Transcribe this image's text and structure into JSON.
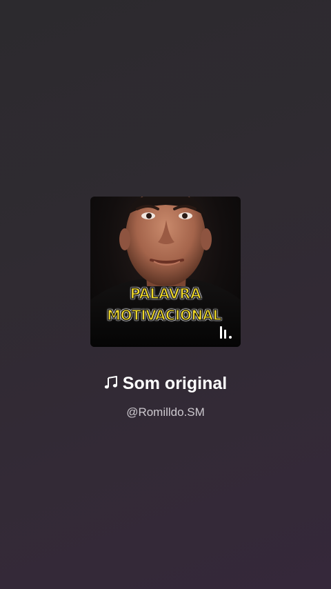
{
  "audio": {
    "cover": {
      "line1": "PALAVRA",
      "line2": "MOTIVACIONAL"
    },
    "title": "Som original",
    "author": "@Romilldo.SM",
    "icons": {
      "title_icon": "music-note-icon",
      "cover_badge": "sound-bars-icon"
    },
    "colors": {
      "background": "#302b33",
      "title": "#ffffff",
      "author": "#cdc9cf",
      "cover_text": "#f3dc2a"
    }
  }
}
